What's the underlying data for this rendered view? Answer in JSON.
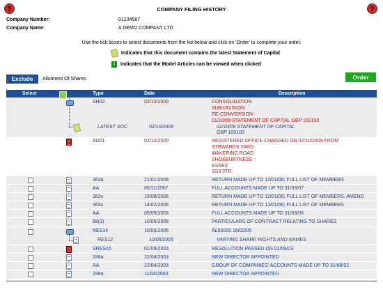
{
  "title": "COMPANY FILING HISTORY",
  "company": {
    "number_label": "Company Number:",
    "number_value": "01234567",
    "name_label": "Company Name:",
    "name_value": "A DEMO COMPANY LTD"
  },
  "instructions": "Use the tick boxes to select documents from the list below and click on 'Order' to complete your order.",
  "legend": {
    "soc": "Indicates that this document contains the latest Statement of Capital",
    "articles": "Indicates that the Model Articles can be viewed when clicked"
  },
  "toolbar": {
    "exclude_label": "Exclude",
    "exclude_text": "Allotment Of Shares",
    "order_label": "Order"
  },
  "table": {
    "headers": [
      "Select",
      "Type",
      "Date",
      "Description"
    ],
    "consolidation": {
      "type": "SH02",
      "date": "02/10/2009",
      "lines": [
        "CONSOLIDATION",
        "SUB-DIVISION",
        "RE-CONVERSION",
        "01/10/09 STATEMENT OF CAPITAL GBP 100100"
      ],
      "sub_type": "LATEST SOC",
      "sub_date": "02/10/2009",
      "sub_lines": [
        "02/10/09 STATEMENT OF CAPITAL",
        "GBP 100100"
      ]
    },
    "ad01": {
      "type": "AD01",
      "date": "02/10/2009",
      "lines": [
        "REGISTERED OFFICE CHANGED ON 02/10/2009 FROM",
        "STEWARDS YARD",
        "WAKERING ROAD",
        "SHOEBURYNESS",
        "ESSEX",
        "SS3 9TR"
      ]
    },
    "rows": [
      {
        "type": "363a",
        "date": "21/01/2008",
        "desc": "RETURN MADE UP TO 12/01/08; FULL LIST OF MEMBERS"
      },
      {
        "type": "AA",
        "date": "05/11/2007",
        "desc": "FULL ACCOUNTS MADE UP TO 31/03/07"
      },
      {
        "type": "363s",
        "date": "15/08/2006",
        "desc": "RETURN MADE UP TO 12/01/06; FULL LIST OF MEMBERS; AMEND"
      },
      {
        "type": "363s",
        "date": "14/02/2006",
        "desc": "RETURN MADE UP TO 12/01/06; FULL LIST OF MEMBERS"
      },
      {
        "type": "AA",
        "date": "05/09/2005",
        "desc": "FULL ACCOUNTS MADE UP TO 31/03/05"
      },
      {
        "type": "88(3)",
        "date": "10/05/2005",
        "desc": "PARTICULARS OF CONTRACT RELATING TO SHARES"
      }
    ],
    "res14": {
      "type": "RES14",
      "date": "10/05/2005",
      "desc": "Â£50000 16/02/05",
      "sub_type": "RES12",
      "sub_date": "10/05/2005",
      "sub_desc": "VARYING SHARE RIGHTS AND NAMES"
    },
    "tail_rows": [
      {
        "type": "SRES15",
        "date": "01/09/2003",
        "desc": "RESOLUTION PASSED ON 01/09/03",
        "red_icon": true
      },
      {
        "type": "288a",
        "date": "22/04/2003",
        "desc": "NEW DIRECTOR APPOINTED"
      },
      {
        "type": "AA",
        "date": "22/04/2003",
        "desc": "GROUP OF COMPANIES' ACCOUNTS MADE UP TO 31/08/02"
      },
      {
        "type": "288a",
        "date": "11/04/2003",
        "desc": "NEW DIRECTOR APPOINTED"
      }
    ]
  }
}
